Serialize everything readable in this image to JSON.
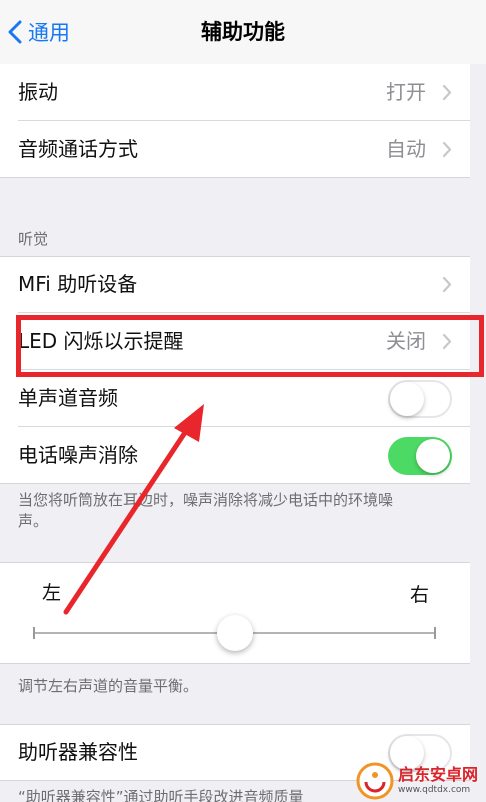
{
  "nav": {
    "back_label": "通用",
    "title": "辅助功能"
  },
  "group1": {
    "vibration": {
      "label": "振动",
      "value": "打开"
    },
    "call_audio": {
      "label": "音频通话方式",
      "value": "自动"
    }
  },
  "hearing": {
    "header": "听觉",
    "mfi": {
      "label": "MFi 助听设备"
    },
    "led_flash": {
      "label": "LED 闪烁以示提醒",
      "value": "关闭"
    },
    "mono_audio": {
      "label": "单声道音频",
      "enabled": false
    },
    "noise_cancel": {
      "label": "电话噪声消除",
      "enabled": true
    },
    "footer": "当您将听筒放在耳边时，噪声消除将减少电话中的环境噪声。"
  },
  "balance": {
    "left_label": "左",
    "right_label": "右",
    "value": 0.5,
    "footer": "调节左右声道的音量平衡。"
  },
  "hearing_aid": {
    "label": "助听器兼容性",
    "enabled": false,
    "footer_partial": "“助听器兼容性”通过助听手段改进音频质量"
  },
  "watermark": {
    "title": "启东安卓网",
    "subtitle": "www.qdtdx.com"
  },
  "colors": {
    "accent": "#1877f2",
    "switch_on": "#4cd964",
    "highlight": "#e8262b"
  },
  "icons": {
    "back": "chevron-left-icon",
    "disclosure": "chevron-right-icon"
  }
}
